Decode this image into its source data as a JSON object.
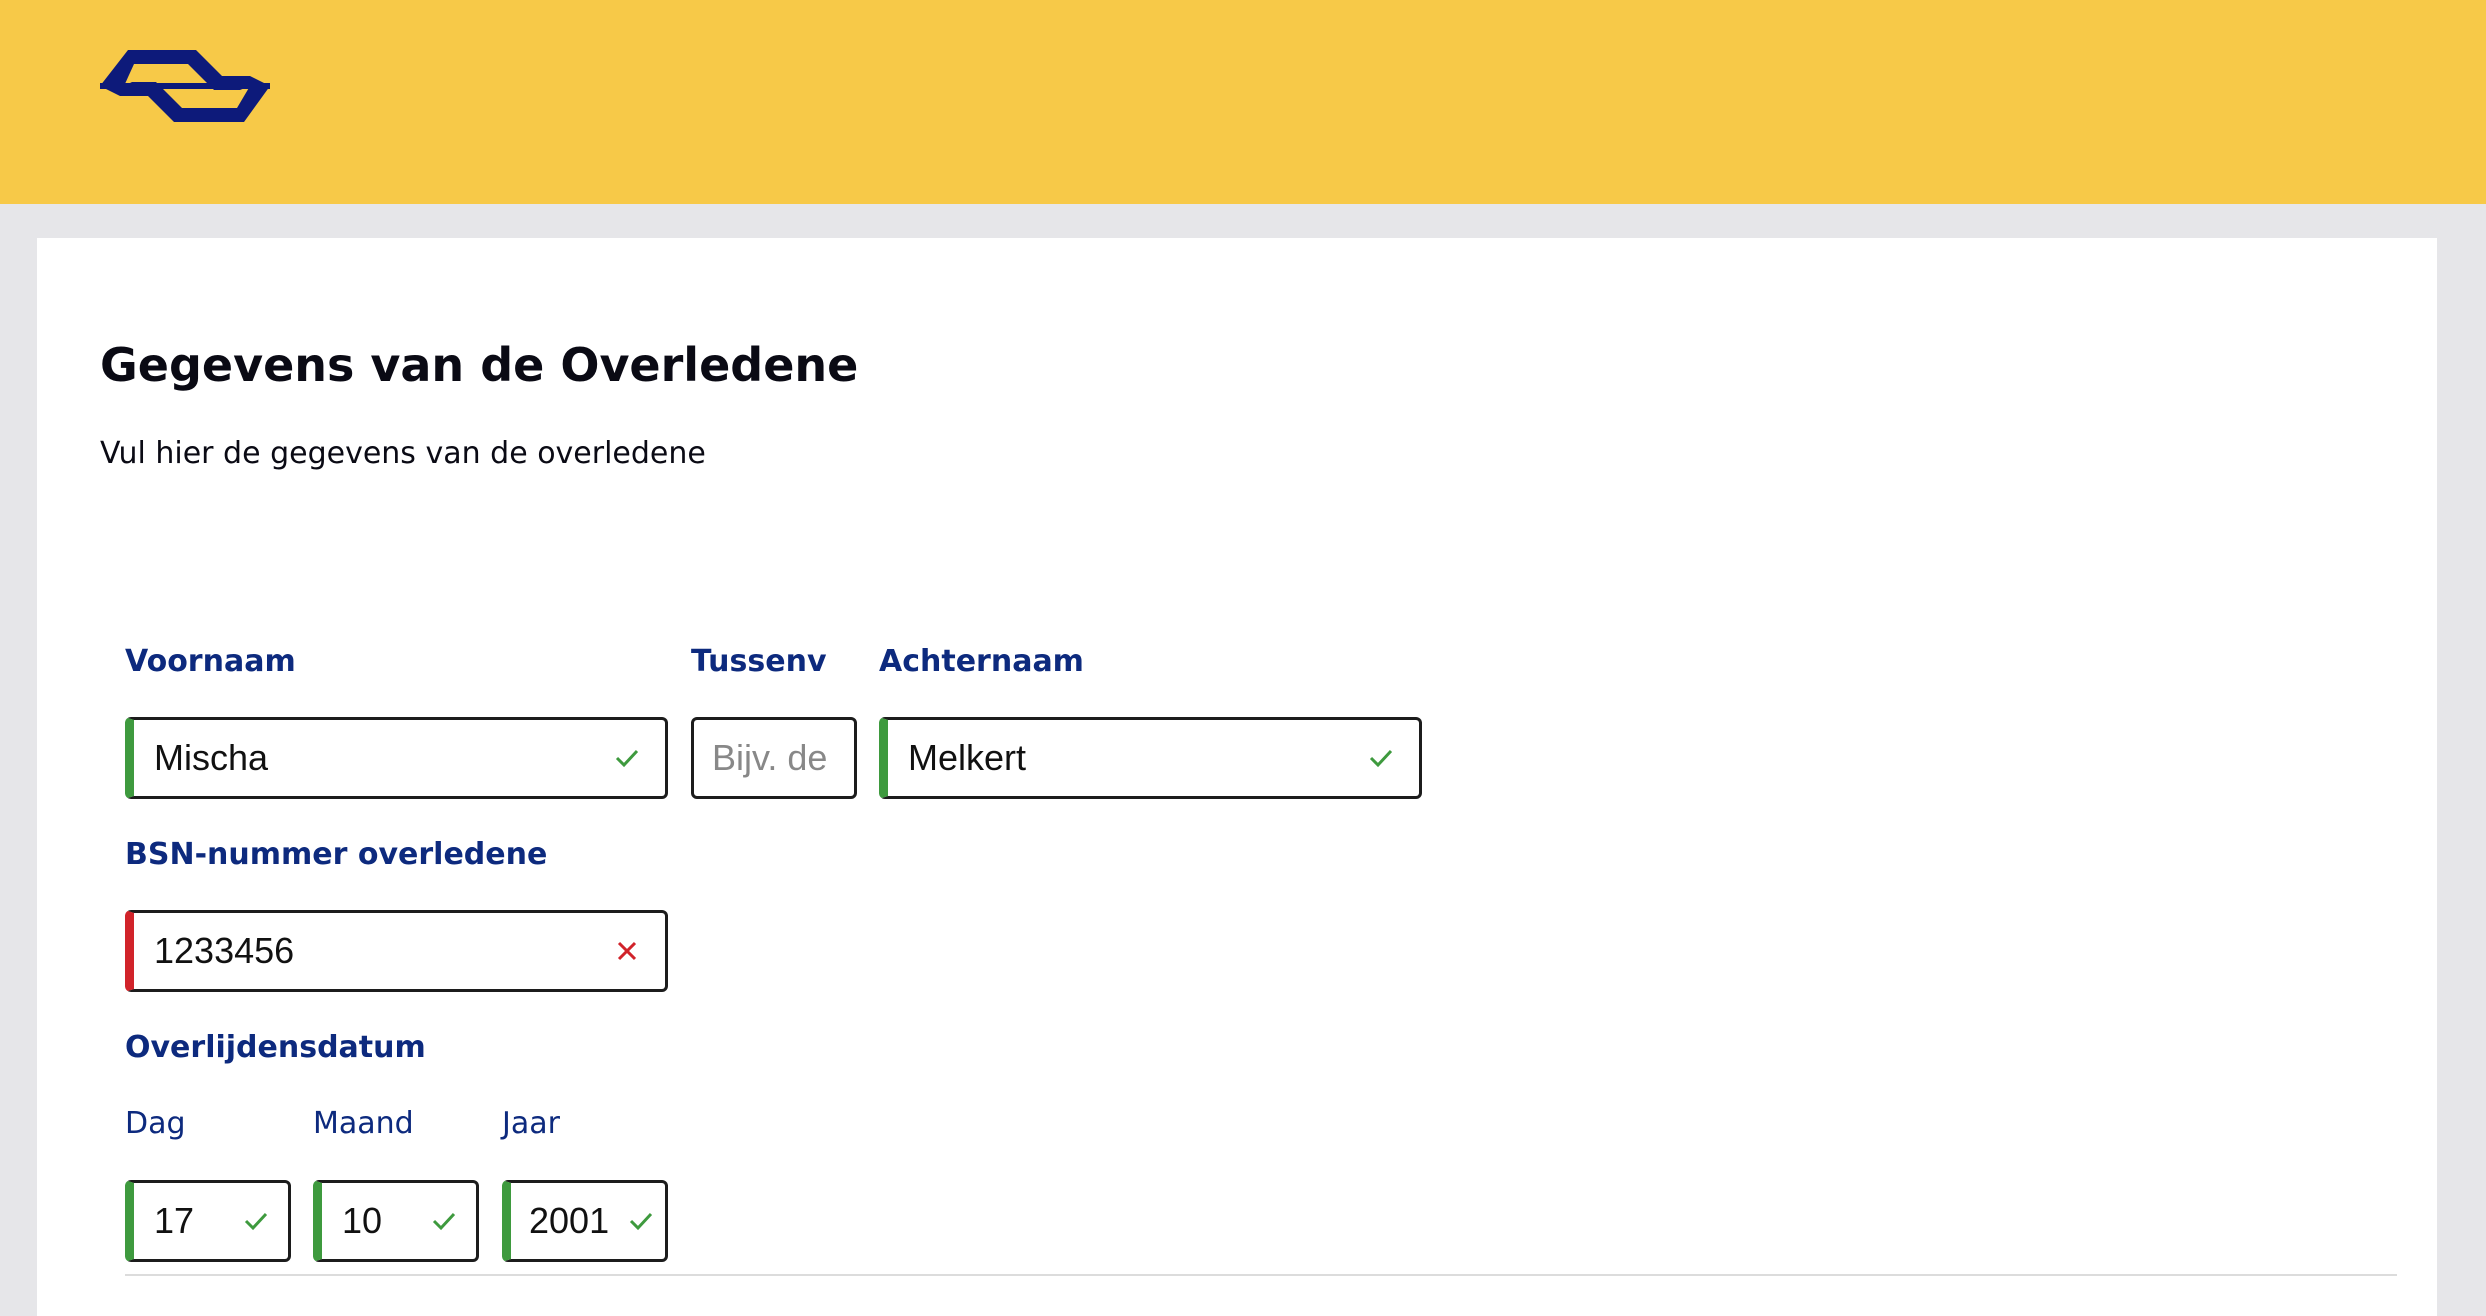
{
  "colors": {
    "header_bg": "#f7c948",
    "logo": "#0d1a7a",
    "label": "#0d2a7e",
    "valid": "#3e9a3e",
    "invalid": "#d1232a"
  },
  "header": {
    "logo_icon": "ns-logo-icon"
  },
  "page": {
    "title": "Gegevens van de Overledene",
    "subtitle": "Vul hier de gegevens van de overledene"
  },
  "form": {
    "voornaam": {
      "label": "Voornaam",
      "value": "Mischa",
      "status": "valid"
    },
    "tussenvoegsel": {
      "label": "Tussenv",
      "value": "",
      "placeholder": "Bijv. de"
    },
    "achternaam": {
      "label": "Achternaam",
      "value": "Melkert",
      "status": "valid"
    },
    "bsn": {
      "label": "BSN-nummer overledene",
      "value": "1233456",
      "status": "invalid"
    },
    "overlijdensdatum": {
      "label": "Overlijdensdatum",
      "dag": {
        "label": "Dag",
        "value": "17",
        "status": "valid"
      },
      "maand": {
        "label": "Maand",
        "value": "10",
        "status": "valid"
      },
      "jaar": {
        "label": "Jaar",
        "value": "2001",
        "status": "valid"
      }
    }
  }
}
